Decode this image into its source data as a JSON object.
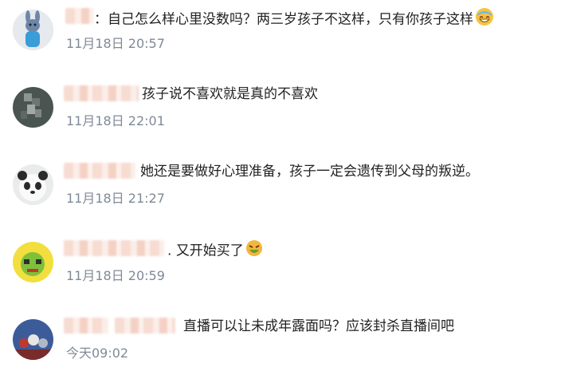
{
  "comments": [
    {
      "prefix": "：",
      "text": "自己怎么样心里没数吗？两三岁孩子不这样，只有你孩子这样",
      "emoji": "grinning-sweat-emoji",
      "time": "11月18日 20:57"
    },
    {
      "prefix": "",
      "text": "孩子说不喜欢就是真的不喜欢",
      "time": "11月18日 22:01"
    },
    {
      "prefix": "",
      "text": "她还是要做好心理准备，孩子一定会遗传到父母的叛逆。",
      "time": "11月18日 21:27"
    },
    {
      "prefix": ".",
      "text": "又开始买了",
      "emoji": "angry-nauseated-emoji",
      "time": "11月18日 20:59"
    },
    {
      "prefix": "",
      "text": "直播可以让未成年露面吗？应该封杀直播间吧",
      "time": "今天09:02"
    }
  ]
}
